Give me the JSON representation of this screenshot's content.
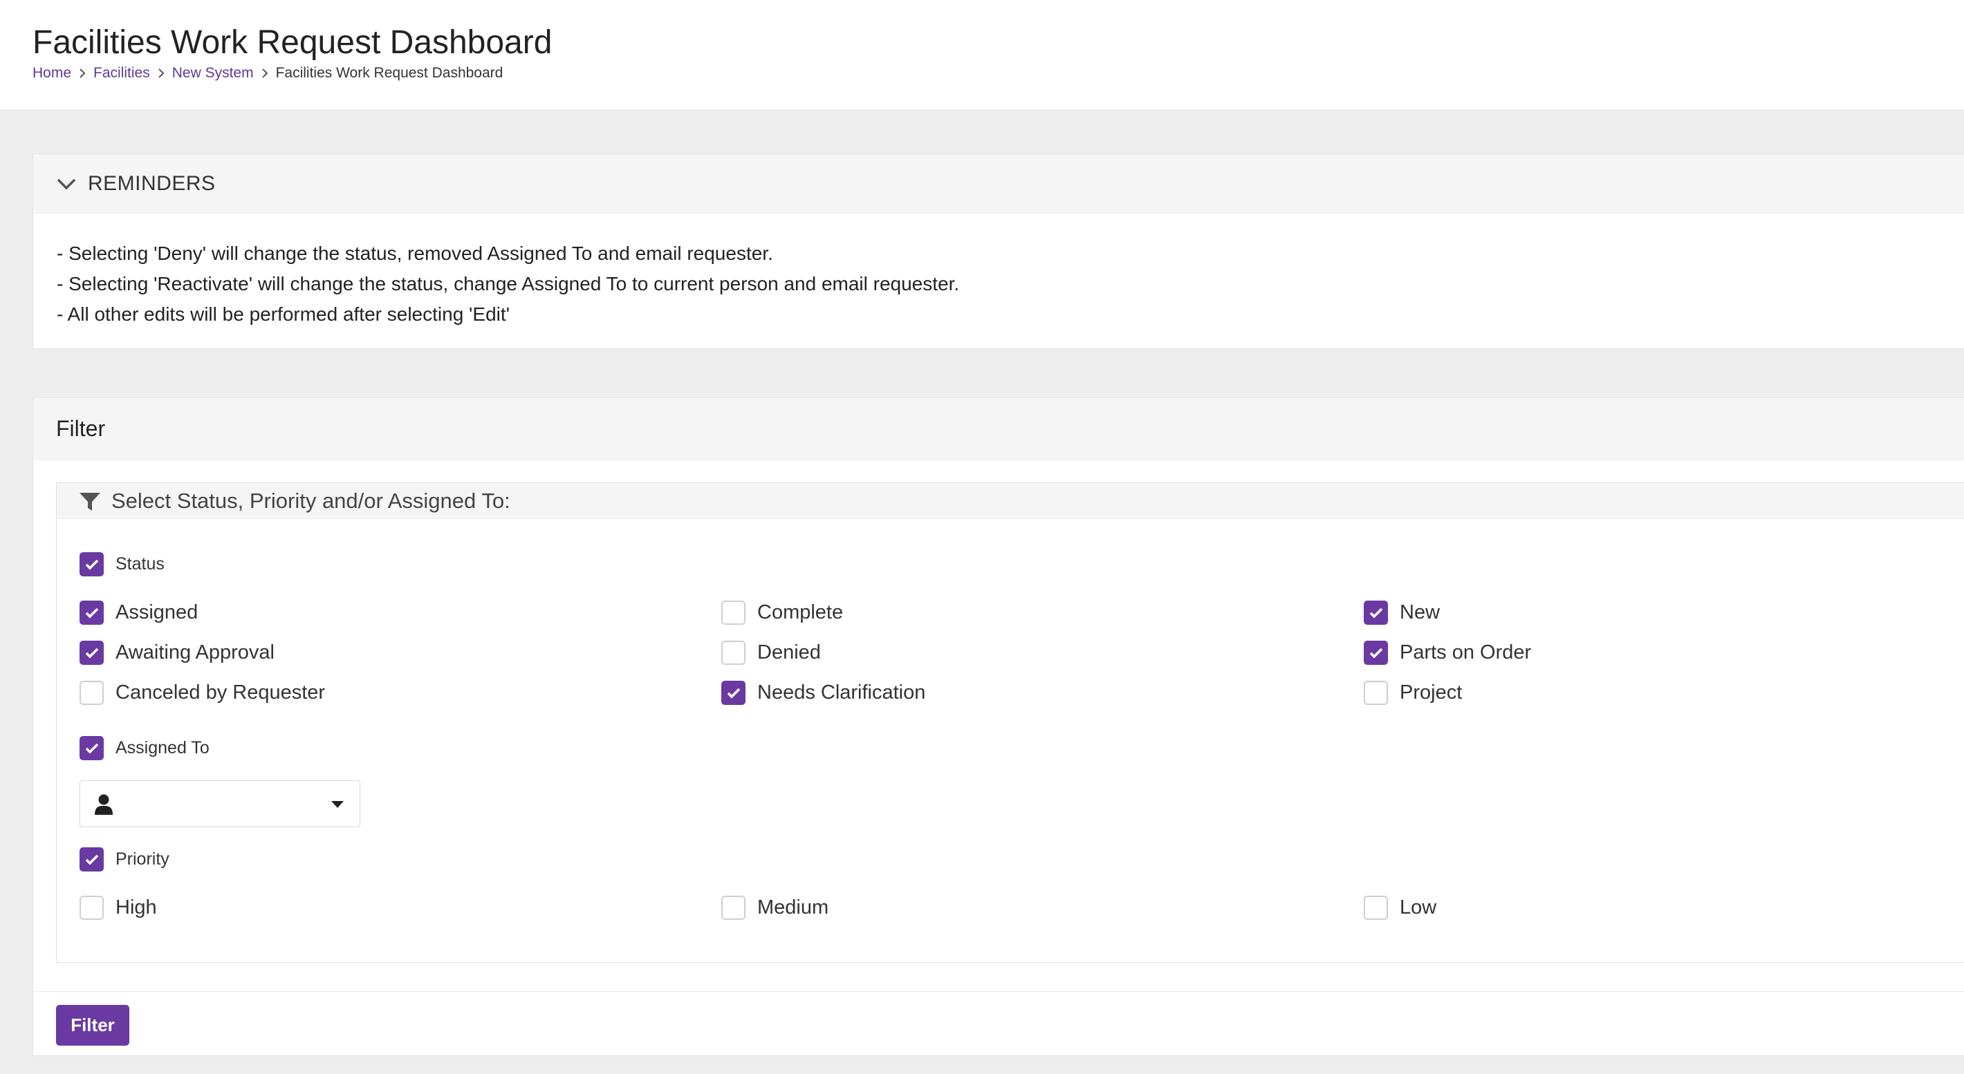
{
  "header": {
    "title": "Facilities Work Request Dashboard",
    "breadcrumb": [
      {
        "label": "Home"
      },
      {
        "label": "Facilities"
      },
      {
        "label": "New System"
      },
      {
        "label": "Facilities Work Request Dashboard"
      }
    ]
  },
  "reminders": {
    "title": "REMINDERS",
    "lines": [
      "- Selecting 'Deny' will change the status, removed Assigned To and email requester.",
      "- Selecting 'Reactivate' will change the status, change Assigned To to current person and email requester.",
      "- All other edits will be performed after selecting 'Edit'"
    ]
  },
  "filter": {
    "title": "Filter",
    "section_title": "Select Status, Priority and/or Assigned To:",
    "status": {
      "label": "Status",
      "checked": true,
      "options": [
        {
          "label": "Assigned",
          "checked": true
        },
        {
          "label": "Awaiting Approval",
          "checked": true
        },
        {
          "label": "Canceled by Requester",
          "checked": false
        },
        {
          "label": "Complete",
          "checked": false
        },
        {
          "label": "Denied",
          "checked": false
        },
        {
          "label": "Needs Clarification",
          "checked": true
        },
        {
          "label": "New",
          "checked": true
        },
        {
          "label": "Parts on Order",
          "checked": true
        },
        {
          "label": "Project",
          "checked": false
        }
      ]
    },
    "assigned_to": {
      "label": "Assigned To",
      "checked": true,
      "selected_value": ""
    },
    "priority": {
      "label": "Priority",
      "checked": true,
      "options": [
        {
          "label": "High",
          "checked": false
        },
        {
          "label": "Medium",
          "checked": false
        },
        {
          "label": "Low",
          "checked": false
        }
      ]
    },
    "button_label": "Filter"
  },
  "colors": {
    "accent": "#6a3aa2",
    "link": "#5c3a97",
    "page_background": "#eeeeee"
  },
  "icons": {
    "reminders_toggle": "chevron-down-icon",
    "filter_section": "funnel-icon",
    "assignee": "user-icon",
    "dropdown": "caret-down-icon",
    "breadcrumb_separator": "chevron-right-icon",
    "checkbox_mark": "check-icon"
  }
}
